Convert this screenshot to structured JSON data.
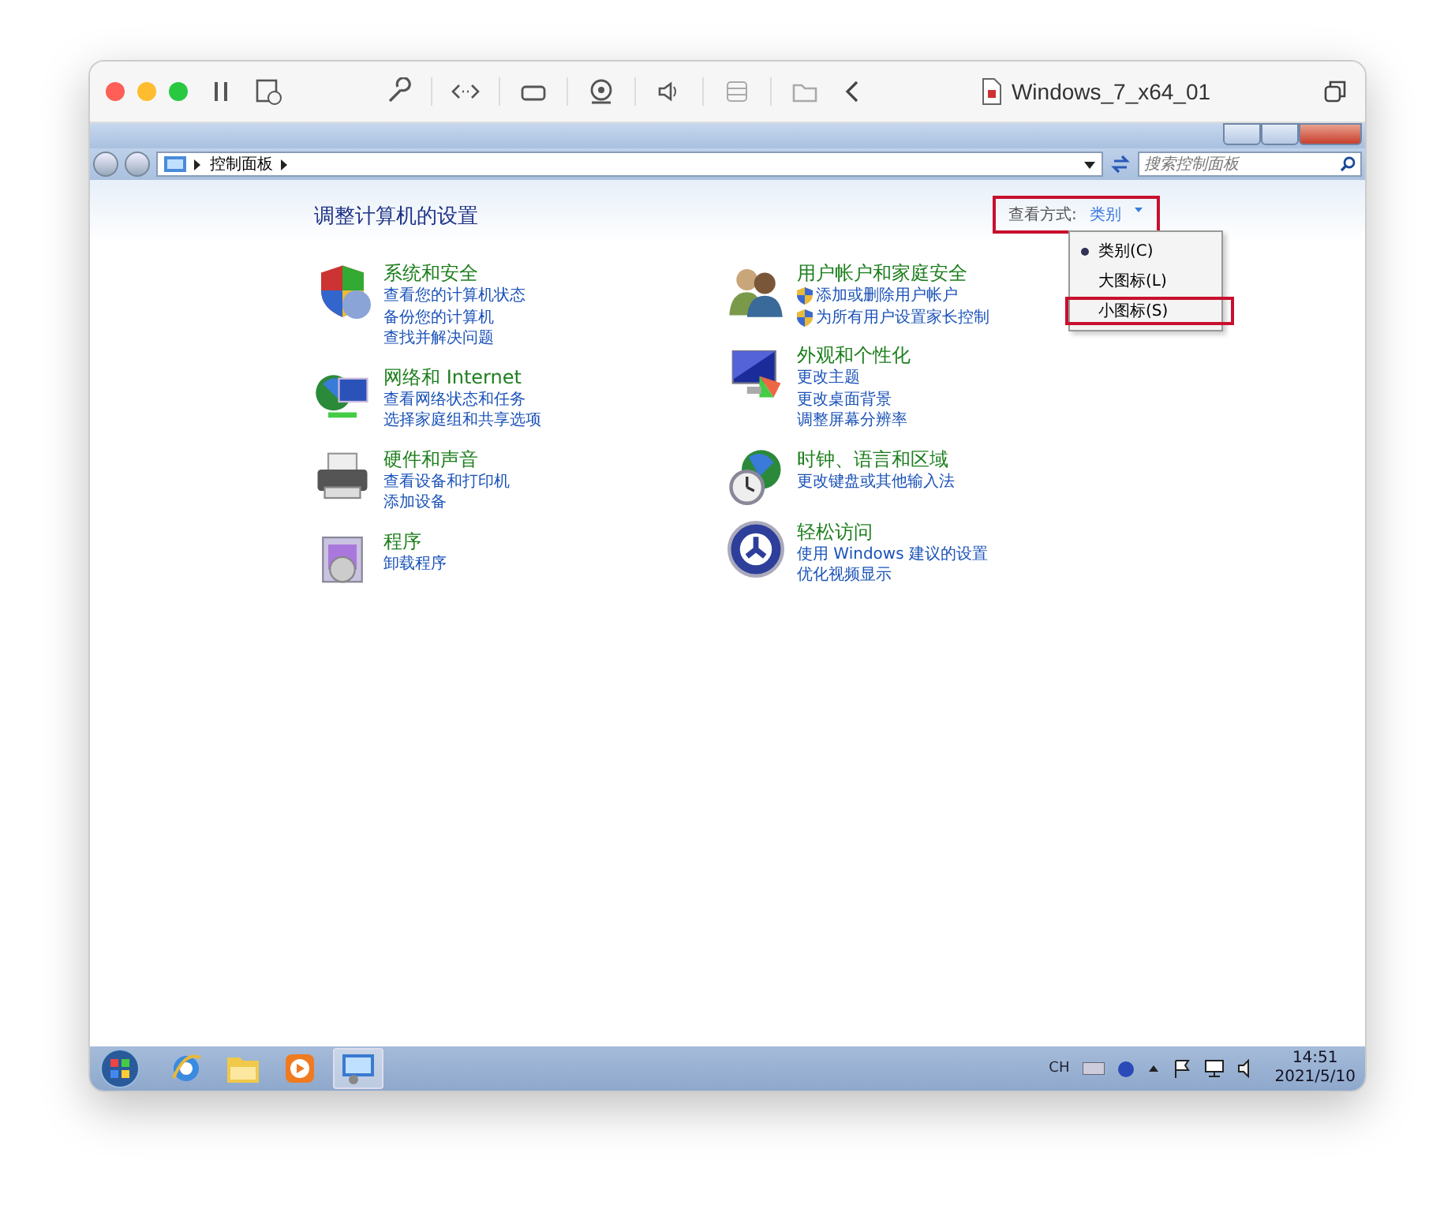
{
  "window": {
    "title": "Windows_7_x64_01"
  },
  "address_bar": {
    "breadcrumb": [
      "控制面板"
    ],
    "search": {
      "placeholder": "搜索控制面板"
    }
  },
  "heading": "调整计算机的设置",
  "view_by": {
    "label": "查看方式:",
    "value": "类别",
    "highlighted": true
  },
  "view_menu": [
    {
      "label": "类别(C)",
      "selected": true,
      "highlighted": false
    },
    {
      "label": "大图标(L)",
      "selected": false,
      "highlighted": false
    },
    {
      "label": "小图标(S)",
      "selected": false,
      "highlighted": true
    }
  ],
  "categories": [
    {
      "title": "系统和安全",
      "links": [
        {
          "text": "查看您的计算机状态",
          "shield": false
        },
        {
          "text": "备份您的计算机",
          "shield": false
        },
        {
          "text": "查找并解决问题",
          "shield": false
        }
      ]
    },
    {
      "title": "网络和 Internet",
      "links": [
        {
          "text": "查看网络状态和任务",
          "shield": false
        },
        {
          "text": "选择家庭组和共享选项",
          "shield": false
        }
      ]
    },
    {
      "title": "硬件和声音",
      "links": [
        {
          "text": "查看设备和打印机",
          "shield": false
        },
        {
          "text": "添加设备",
          "shield": false
        }
      ]
    },
    {
      "title": "程序",
      "links": [
        {
          "text": "卸载程序",
          "shield": false
        }
      ]
    },
    {
      "title": "用户帐户和家庭安全",
      "links": [
        {
          "text": "添加或删除用户帐户",
          "shield": true
        },
        {
          "text": "为所有用户设置家长控制",
          "shield": true
        }
      ]
    },
    {
      "title": "外观和个性化",
      "links": [
        {
          "text": "更改主题",
          "shield": false
        },
        {
          "text": "更改桌面背景",
          "shield": false
        },
        {
          "text": "调整屏幕分辨率",
          "shield": false
        }
      ]
    },
    {
      "title": "时钟、语言和区域",
      "links": [
        {
          "text": "更改键盘或其他输入法",
          "shield": false
        }
      ]
    },
    {
      "title": "轻松访问",
      "links": [
        {
          "text": "使用 Windows 建议的设置",
          "shield": false
        },
        {
          "text": "优化视频显示",
          "shield": false
        }
      ]
    }
  ],
  "taskbar": {
    "input_language": "CH",
    "time": "14:51",
    "date": "2021/5/10"
  }
}
